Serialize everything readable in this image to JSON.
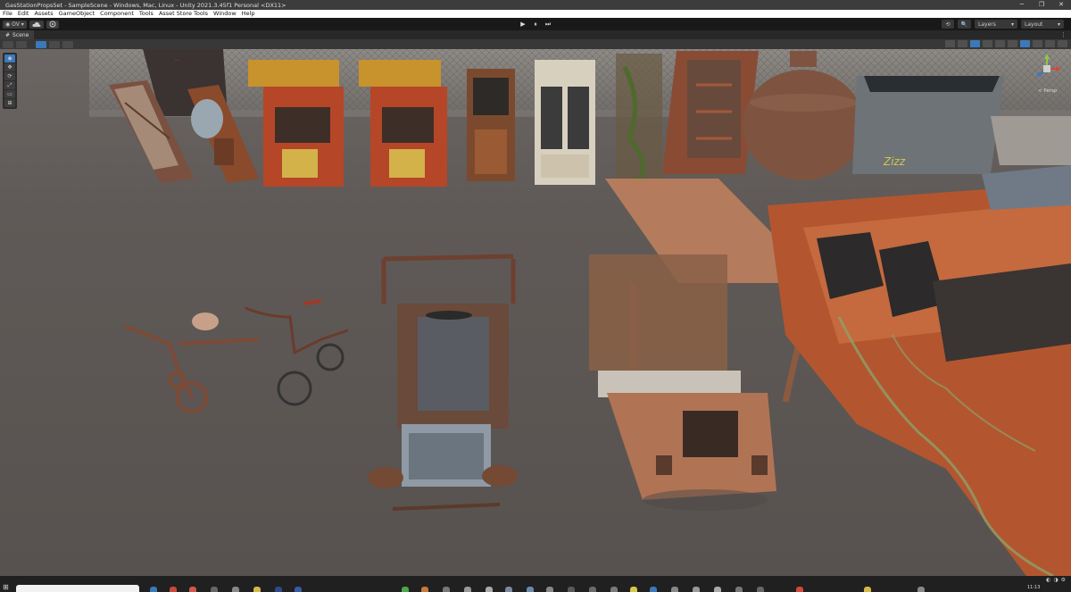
{
  "window": {
    "title": "GasStationPropsSet - SampleScene - Windows, Mac, Linux - Unity 2021.3.45f1 Personal <DX11>",
    "controls": [
      "─",
      "❐",
      "✕"
    ]
  },
  "menu": [
    "File",
    "Edit",
    "Assets",
    "GameObject",
    "Component",
    "Tools",
    "Asset Store Tools",
    "Window",
    "Help"
  ],
  "toolbar": {
    "account_label": "OV ▾",
    "cloud_icon": "cloud-icon",
    "collab_icon": "collab-icon",
    "play_icon": "▶",
    "pause_icon": "⏸",
    "step_icon": "⏭",
    "history_icon": "⟲",
    "search_icon": "🔍",
    "layers_label": "Layers",
    "layout_label": "Layout"
  },
  "scene_tab": {
    "label": "Scene",
    "more": "⋮"
  },
  "gizmo": {
    "persp_label": "< Persp"
  },
  "tools": [
    "◉",
    "✥",
    "⟳",
    "⤢",
    "▭",
    "⊞"
  ],
  "taskbar": {
    "clock_time": "11:13"
  },
  "colors": {
    "accent": "#3a79bb",
    "viewport_bg": "#5f5a58",
    "rust": "#a6542c"
  }
}
